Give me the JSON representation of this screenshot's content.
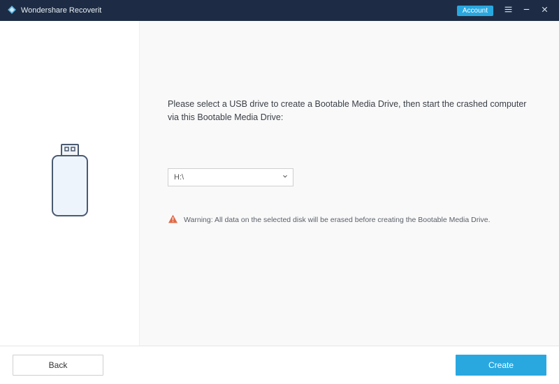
{
  "titlebar": {
    "app_name": "Wondershare Recoverit",
    "account_label": "Account"
  },
  "main": {
    "instruction": "Please select a USB drive to create a Bootable Media Drive, then start the crashed computer via this Bootable Media Drive:",
    "selected_drive": "H:\\",
    "warning_text": "Warning: All data on the selected disk will be erased before creating the Bootable Media Drive."
  },
  "footer": {
    "back_label": "Back",
    "create_label": "Create"
  },
  "colors": {
    "accent": "#29a8e0",
    "titlebar_bg": "#1d2c44",
    "warning": "#e06a47"
  }
}
